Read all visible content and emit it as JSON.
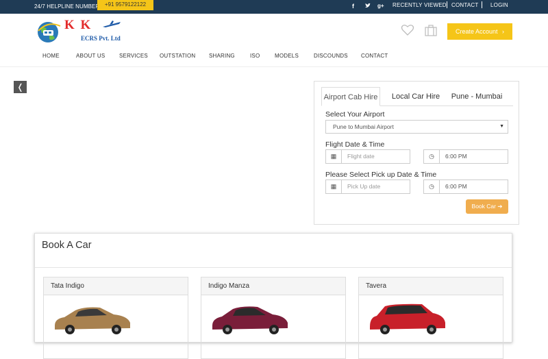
{
  "topbar": {
    "helpline_label": "24/7 HELPLINE NUMBER-",
    "phone": "+91 9579122122",
    "social_icons": [
      "facebook-icon",
      "twitter-icon",
      "google-plus-icon"
    ],
    "links": {
      "recently_viewed": "RECENTLY VIEWED",
      "contact": "CONTACT",
      "login": "LOGIN"
    }
  },
  "header": {
    "logo_title": "K K",
    "logo_subtitle": "ECRS Pvt. Ltd",
    "create_account": "Create Account",
    "nav": [
      "HOME",
      "ABOUT US",
      "SERVICES",
      "OUTSTATION",
      "SHARING",
      "ISO",
      "MODELS",
      "DISCOUNDS",
      "CONTACT"
    ]
  },
  "slider": {
    "prev": "❬",
    "next": "❭"
  },
  "booking": {
    "tabs": [
      "Airport Cab Hire",
      "Local Car Hire",
      "Pune - Mumbai"
    ],
    "active_tab": "Airport Cab Hire",
    "airport_label": "Select Your Airport",
    "airport_value": "Pune to Mumbai Airport",
    "flight_label": "Flight Date & Time",
    "flight_date_placeholder": "Flight date",
    "flight_time": "6:00 PM",
    "pickup_label": "Please Select Pick up Date & Time",
    "pickup_date_placeholder": "Pick Up date",
    "pickup_time": "6:00 PM",
    "book_button": "Book Car"
  },
  "book_a_car": {
    "title": "Book A Car",
    "cars": [
      {
        "name": "Tata Indigo",
        "color": "#a8814f"
      },
      {
        "name": "Indigo Manza",
        "color": "#7a1e3a"
      },
      {
        "name": "Tavera",
        "color": "#c8202a"
      }
    ]
  },
  "colors": {
    "topbar": "#1f3b55",
    "accent_yellow": "#f5c518",
    "book_button": "#f0ad4e"
  }
}
